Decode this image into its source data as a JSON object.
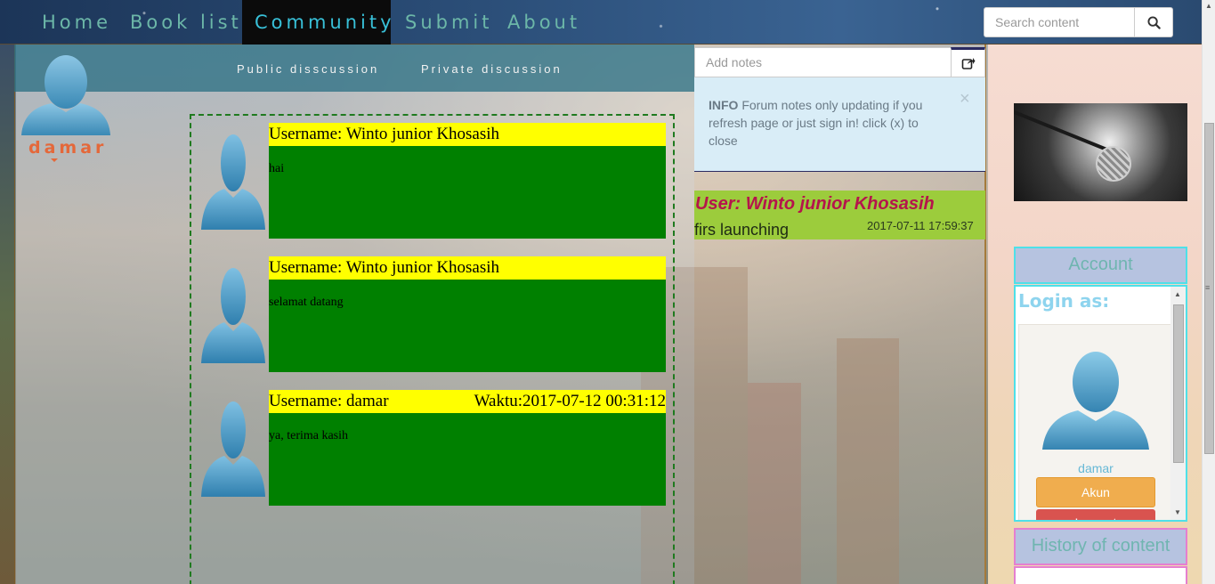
{
  "nav": {
    "items": [
      {
        "label": "Home",
        "active": false
      },
      {
        "label": "Book list",
        "active": false
      },
      {
        "label": "Community",
        "active": true
      },
      {
        "label": "Submit",
        "active": false
      },
      {
        "label": "About",
        "active": false
      }
    ],
    "search_placeholder": "Search content"
  },
  "profile": {
    "name": "damar"
  },
  "subnav": {
    "public": "Public disscussion",
    "private": "Private discussion"
  },
  "messages": [
    {
      "username": "Username: Winto junior Khosasih",
      "time": "",
      "text": "hai"
    },
    {
      "username": "Username: Winto junior Khosasih",
      "time": "",
      "text": "selamat datang"
    },
    {
      "username": "Username: damar",
      "time": "Waktu:2017-07-12 00:31:12",
      "text": "ya, terima kasih"
    }
  ],
  "notes": {
    "placeholder": "Add notes",
    "info_label": "INFO",
    "info_text": " Forum notes only updating if you refresh page or just sign in! click (x) to close",
    "close_symbol": "×",
    "card": {
      "user": "User: Winto junior Khosasih",
      "text": "firs launching",
      "time": "2017-07-11 17:59:37"
    }
  },
  "account": {
    "header": "Account",
    "login_as": "Login as:",
    "username": "damar",
    "akun_button": "Akun",
    "logout_button": "Log out"
  },
  "history": {
    "header": "History of content"
  },
  "colors": {
    "msg_head": "#ffff00",
    "msg_body": "#008000",
    "nav_active_bg": "#0b0b0b",
    "nav_text": "#6cb7a8",
    "note_user": "#b5144c"
  }
}
